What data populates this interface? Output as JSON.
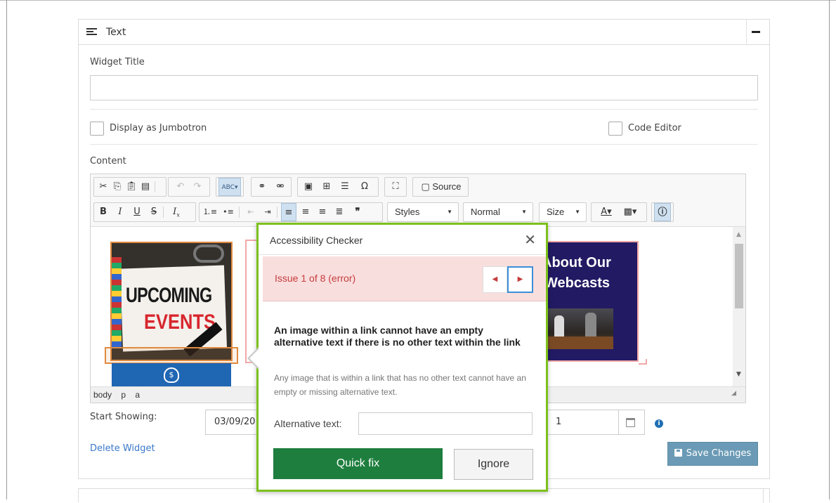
{
  "panel": {
    "title": "Text",
    "widget_title_label": "Widget Title",
    "widget_title_value": "",
    "jumbotron_label": "Display as Jumbotron",
    "code_editor_label": "Code Editor",
    "content_label": "Content"
  },
  "toolbar": {
    "source_label": "Source",
    "styles_label": "Styles",
    "format_label": "Normal",
    "size_label": "Size"
  },
  "editor": {
    "path": [
      "body",
      "p",
      "a"
    ],
    "images": {
      "events_line1": "UPCOMING",
      "events_line2": "EVENTS",
      "webcasts_line1": "About Our",
      "webcasts_line2": "Webcasts"
    }
  },
  "schedule": {
    "start_label": "Start Showing:",
    "start_value": "03/09/20",
    "end_value": "1"
  },
  "actions": {
    "delete_label": "Delete Widget",
    "save_label": "Save Changes"
  },
  "a11y": {
    "title": "Accessibility Checker",
    "issue_text": "Issue 1 of 8 (error)",
    "message": "An image within a link cannot have an empty alternative text if there is no other text within the link",
    "description": "Any image that is within a link that has no other text cannot have an empty or missing alternative text.",
    "alt_label": "Alternative text:",
    "alt_value": "",
    "quick_fix_label": "Quick fix",
    "ignore_label": "Ignore"
  },
  "colors": {
    "dialog_border": "#7dc11d",
    "error_bg": "#f9dede",
    "error_text": "#c63b3b",
    "quick_fix": "#1e7e3e",
    "save_button": "#6a9ab5",
    "link": "#3a78c9"
  }
}
